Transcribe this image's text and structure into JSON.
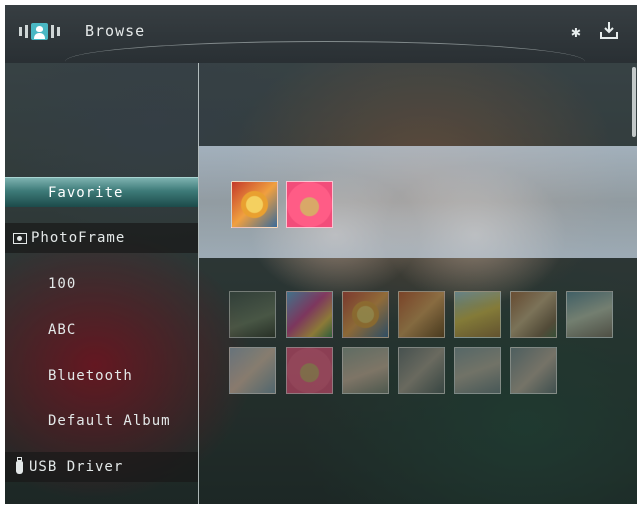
{
  "app": {
    "title": "Browse",
    "icons": [
      "photo-mode-icon",
      "bluetooth-icon",
      "download-icon"
    ]
  },
  "menu": {
    "items": [
      {
        "label": "Favorite",
        "type": "album",
        "selected": true
      },
      {
        "label": "PhotoFrame",
        "type": "source-header",
        "icon": "photoframe-icon"
      },
      {
        "label": "100",
        "type": "album"
      },
      {
        "label": "ABC",
        "type": "album"
      },
      {
        "label": "Bluetooth",
        "type": "album"
      },
      {
        "label": "Default Album",
        "type": "album"
      },
      {
        "label": "USB Driver",
        "type": "source-header",
        "icon": "usb-drive-icon"
      }
    ]
  },
  "favorite_preview": {
    "thumbnails": [
      "sunflower-photo",
      "pink-flower-photo"
    ]
  },
  "thumbnail_grid": {
    "rows": [
      [
        "photo-1",
        "photo-2",
        "photo-3",
        "photo-4",
        "photo-5",
        "photo-6",
        "photo-7"
      ],
      [
        "photo-8",
        "photo-9",
        "photo-10",
        "photo-11",
        "photo-12",
        "photo-13"
      ]
    ]
  },
  "colors": {
    "accent": "#49b8c4",
    "selection": "#3d7a78"
  }
}
